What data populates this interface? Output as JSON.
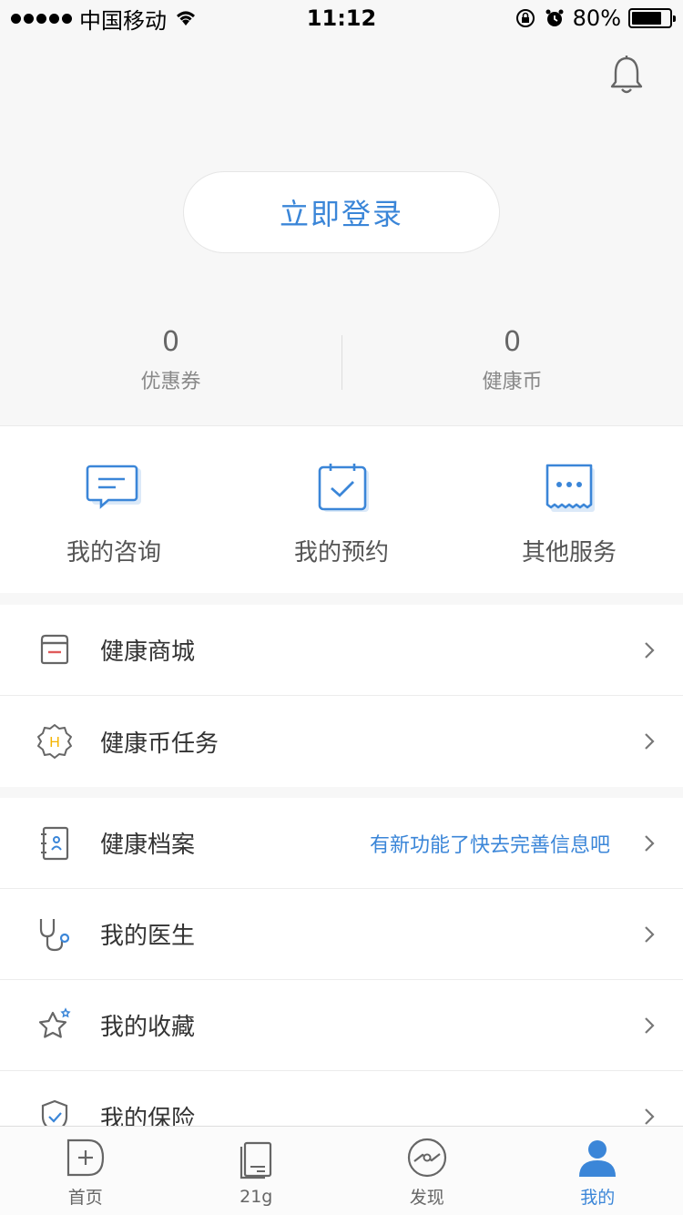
{
  "status_bar": {
    "carrier": "中国移动",
    "time": "11:12",
    "battery_text": "80%",
    "battery_level": 0.8
  },
  "header": {
    "login_label": "立即登录",
    "stats": [
      {
        "value": "0",
        "label": "优惠券"
      },
      {
        "value": "0",
        "label": "健康币"
      }
    ]
  },
  "quick_actions": [
    {
      "label": "我的咨询",
      "icon": "chat-icon"
    },
    {
      "label": "我的预约",
      "icon": "calendar-check-icon"
    },
    {
      "label": "其他服务",
      "icon": "more-services-icon"
    }
  ],
  "group1": [
    {
      "label": "健康商城",
      "icon": "store-box-icon"
    },
    {
      "label": "健康币任务",
      "icon": "coin-badge-icon"
    }
  ],
  "group2": [
    {
      "label": "健康档案",
      "hint": "有新功能了快去完善信息吧",
      "icon": "health-record-icon"
    },
    {
      "label": "我的医生",
      "icon": "stethoscope-icon"
    },
    {
      "label": "我的收藏",
      "icon": "star-icon"
    },
    {
      "label": "我的保险",
      "icon": "shield-icon"
    }
  ],
  "tabbar": [
    {
      "label": "首页",
      "icon": "home-plus-icon"
    },
    {
      "label": "21g",
      "icon": "book-icon"
    },
    {
      "label": "发现",
      "icon": "discover-icon"
    },
    {
      "label": "我的",
      "icon": "profile-icon"
    }
  ],
  "colors": {
    "accent": "#3b86d8",
    "coin": "#f5b400",
    "store_red": "#e05a5a"
  }
}
